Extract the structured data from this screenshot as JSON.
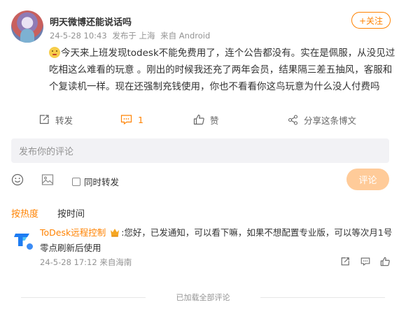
{
  "post": {
    "username": "明天微博还能说话吗",
    "date": "24-5-28 10:43",
    "posted_from": "发布于 上海",
    "source": "来自 Android",
    "follow_label": "+关注",
    "body": "今天来上班发现todesk不能免费用了，连个公告都没有。实在是佩服，从没见过吃相这么难看的玩意 。刚出的时候我还充了两年会员，结果隔三差五抽风，客服和个复读机一样。现在还强制充钱使用，你也不看看你这鸟玩意为什么没人付费吗"
  },
  "actions": {
    "repost": "转发",
    "comment_count": "1",
    "like": "赞",
    "share": "分享这条博文"
  },
  "compose": {
    "placeholder": "发布你的评论",
    "repost_checkbox": "同时转发",
    "submit": "评论"
  },
  "sort": {
    "hot": "按热度",
    "time": "按时间"
  },
  "comment": {
    "username": "ToDesk远程控制",
    "text": ":您好，已发通知，可以看下嘛，如果不想配置专业版，可以等次月1号零点刷新后使用",
    "time": "24-5-28 17:12",
    "location": "来自海南"
  },
  "footer": {
    "end_text": "已加载全部评论"
  },
  "colors": {
    "accent": "#ff8200",
    "submit_disabled": "#ffcb99",
    "meta_gray": "#939393"
  },
  "icons": [
    "emoji-icon",
    "repost-icon",
    "comment-icon",
    "like-icon",
    "share-icon",
    "emoji-picker-icon",
    "image-icon",
    "crown-icon",
    "verified-icon"
  ]
}
